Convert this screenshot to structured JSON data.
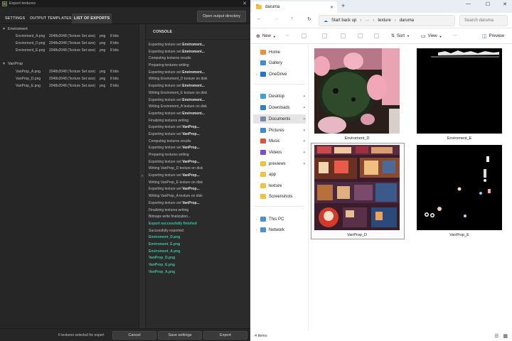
{
  "export_dialog": {
    "title": "Export textures",
    "logo": "Pt",
    "tabs": [
      "SETTINGS",
      "OUTPUT TEMPLATES",
      "LIST OF EXPORTS"
    ],
    "open_dir_label": "Open output directory",
    "groups": [
      {
        "name": "Enviroment",
        "files": [
          {
            "name": "Enviroment_A.png",
            "size": "2048x2048 (Texture Set size)",
            "format": "png",
            "bits": "8 bits"
          },
          {
            "name": "Enviroment_D.png",
            "size": "2048x2048 (Texture Set size)",
            "format": "png",
            "bits": "8 bits"
          },
          {
            "name": "Enviroment_E.png",
            "size": "2048x2048 (Texture Set size)",
            "format": "png",
            "bits": "8 bits"
          }
        ]
      },
      {
        "name": "VanProp",
        "files": [
          {
            "name": "VanProp_A.png",
            "size": "2048x2048 (Texture Set size)",
            "format": "png",
            "bits": "8 bits"
          },
          {
            "name": "VanProp_D.png",
            "size": "2048x2048 (Texture Set size)",
            "format": "png",
            "bits": "8 bits"
          },
          {
            "name": "VanProp_E.png",
            "size": "2048x2048 (Texture Set size)",
            "format": "png",
            "bits": "8 bits"
          }
        ]
      }
    ],
    "console_title": "CONSOLE",
    "console_lines": [
      {
        "text": "Exporting texture set ",
        "bold": "Enviroment...",
        "ok": false
      },
      {
        "text": "Exporting texture set ",
        "bold": "Enviroment...",
        "ok": false
      },
      {
        "text": "Computing textures results",
        "bold": "",
        "ok": false
      },
      {
        "text": "Preparing textures writing",
        "bold": "",
        "ok": false
      },
      {
        "text": "Exporting texture set ",
        "bold": "Enviroment...",
        "ok": false
      },
      {
        "text": "Writing Enviroment_D texture on disk",
        "bold": "",
        "ok": false
      },
      {
        "text": "Exporting texture set ",
        "bold": "Enviroment...",
        "ok": false
      },
      {
        "text": "Writing Enviroment_E texture on disk",
        "bold": "",
        "ok": false
      },
      {
        "text": "Exporting texture set ",
        "bold": "Enviroment...",
        "ok": false
      },
      {
        "text": "Writing Enviroment_A texture on disk",
        "bold": "",
        "ok": false
      },
      {
        "text": "Exporting texture set ",
        "bold": "Enviroment...",
        "ok": false
      },
      {
        "text": "Finalizing textures writing",
        "bold": "",
        "ok": false
      },
      {
        "text": "Exporting texture set ",
        "bold": "VanProp...",
        "ok": false
      },
      {
        "text": "Exporting texture set ",
        "bold": "VanProp...",
        "ok": false
      },
      {
        "text": "Computing textures results",
        "bold": "",
        "ok": false
      },
      {
        "text": "Exporting texture set ",
        "bold": "VanProp...",
        "ok": false
      },
      {
        "text": "Preparing textures writing",
        "bold": "",
        "ok": false
      },
      {
        "text": "Exporting texture set ",
        "bold": "VanProp...",
        "ok": false
      },
      {
        "text": "Writing VanProp_D texture on disk",
        "bold": "",
        "ok": false
      },
      {
        "text": "Exporting texture set ",
        "bold": "VanProp...",
        "ok": false
      },
      {
        "text": "Writing VanProp_E texture on disk",
        "bold": "",
        "ok": false
      },
      {
        "text": "Exporting texture set ",
        "bold": "VanProp...",
        "ok": false
      },
      {
        "text": "Writing VanProp_A texture on disk",
        "bold": "",
        "ok": false
      },
      {
        "text": "Exporting texture set ",
        "bold": "VanProp...",
        "ok": false
      },
      {
        "text": "Finalizing textures writing",
        "bold": "",
        "ok": false
      },
      {
        "text": "Bitmaps write finalization...",
        "bold": "",
        "ok": false
      },
      {
        "text": "Export successfully finished",
        "bold": "",
        "ok": true
      },
      {
        "text": "Successfully exported:",
        "bold": "",
        "ok": false
      },
      {
        "text": "Enviroment_D.png",
        "bold": "",
        "ok": true
      },
      {
        "text": "Enviroment_E.png",
        "bold": "",
        "ok": true
      },
      {
        "text": "Enviroment_A.png",
        "bold": "",
        "ok": true
      },
      {
        "text": "VanProp_D.png",
        "bold": "",
        "ok": true
      },
      {
        "text": "VanProp_E.png",
        "bold": "",
        "ok": true
      },
      {
        "text": "VanProp_A.png",
        "bold": "",
        "ok": true
      }
    ],
    "selected_count": "6 textures selected for export",
    "cancel_label": "Cancel",
    "save_settings_label": "Save settings",
    "export_label": "Export",
    "splitter_glyph": "»"
  },
  "explorer": {
    "tab_title": "daruma",
    "breadcrumb": [
      "Start back up",
      "···",
      "texture",
      "daruma"
    ],
    "search_placeholder": "Search daruma",
    "commands": {
      "new": "New",
      "sort": "Sort",
      "view": "View",
      "more": "···",
      "preview": "Preview"
    },
    "nav_items": [
      {
        "label": "Home",
        "icon": "home-icon",
        "color": "#e8913a",
        "pin": false
      },
      {
        "label": "Gallery",
        "icon": "gallery-icon",
        "color": "#3f8fd8",
        "pin": false
      },
      {
        "label": "OneDrive",
        "icon": "cloud-icon",
        "color": "#1f74d8",
        "pin": false
      },
      {
        "label": "Desktop",
        "icon": "desktop-icon",
        "color": "#3aa0e0",
        "pin": true
      },
      {
        "label": "Downloads",
        "icon": "download-icon",
        "color": "#2e7fd0",
        "pin": true
      },
      {
        "label": "Documents",
        "icon": "document-icon",
        "color": "#7a8aa0",
        "pin": true
      },
      {
        "label": "Pictures",
        "icon": "pictures-icon",
        "color": "#3a8ad8",
        "pin": true
      },
      {
        "label": "Music",
        "icon": "music-icon",
        "color": "#e0543a",
        "pin": true
      },
      {
        "label": "Videos",
        "icon": "videos-icon",
        "color": "#7a4ad8",
        "pin": true
      },
      {
        "label": "previews",
        "icon": "folder-icon",
        "color": "#f2c23e",
        "pin": true
      },
      {
        "label": "app",
        "icon": "folder-icon",
        "color": "#f2c23e",
        "pin": false
      },
      {
        "label": "texture",
        "icon": "folder-icon",
        "color": "#f2c23e",
        "pin": false
      },
      {
        "label": "Screenshots",
        "icon": "folder-icon",
        "color": "#f2c23e",
        "pin": false
      },
      {
        "label": "This PC",
        "icon": "pc-icon",
        "color": "#4a90d8",
        "pin": false
      },
      {
        "label": "Network",
        "icon": "network-icon",
        "color": "#4a90d8",
        "pin": false
      }
    ],
    "files": [
      {
        "name": "Enviroment_D"
      },
      {
        "name": "Enviroment_E"
      },
      {
        "name": "VanProp_D"
      },
      {
        "name": "VanProp_E"
      }
    ],
    "item_count": "4 items"
  }
}
